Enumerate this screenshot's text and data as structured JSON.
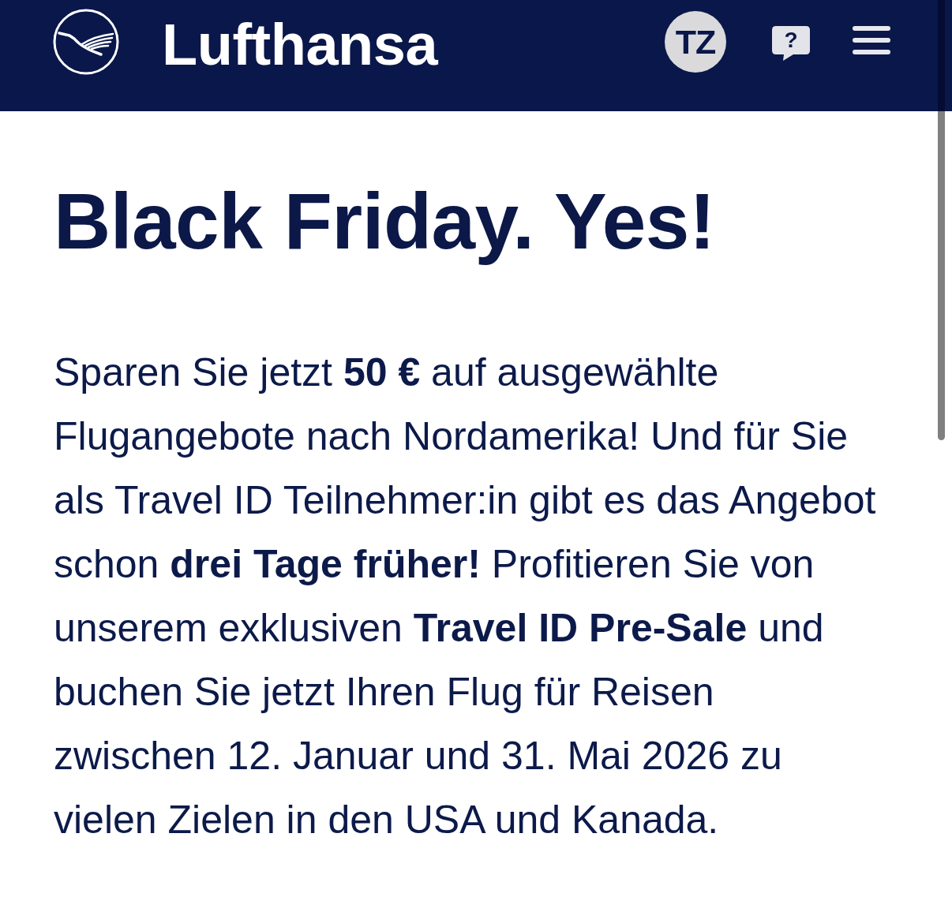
{
  "header": {
    "brand": "Lufthansa",
    "avatar_initials": "TZ",
    "help_glyph": "?"
  },
  "headline": "Black Friday. Yes!",
  "body": "Sparen Sie jetzt **50 €** auf ausgewählte Flugangebote nach Nordamerika! Und für Sie als Travel ID Teilnehmer:in gibt es das Angebot schon **drei Tage früher!** Profitieren Sie von unserem exklusiven **Travel ID Pre-Sale** und buchen Sie jetzt Ihren Flug für Reisen zwischen 12. Januar und 31. Mai 2026 zu vielen Zielen in den USA und Kanada."
}
